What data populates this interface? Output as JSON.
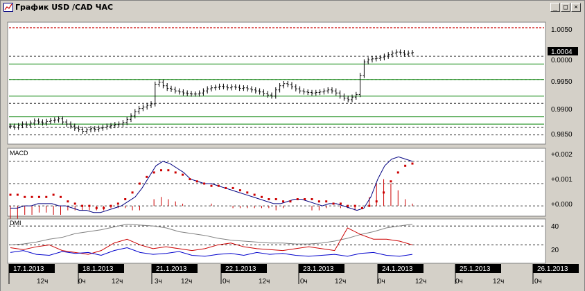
{
  "window": {
    "title": "График USD /CAD  ЧАС",
    "buttons": {
      "minimize": "_",
      "maximize": "□",
      "close": "×"
    }
  },
  "price_panel": {
    "axis_labels": [
      "1.0050",
      "0.9950",
      "0.9900",
      "0.9850"
    ],
    "current_price": "1.0004",
    "partial_label": "0.0000",
    "colors": {
      "bars": "#000000",
      "level_red": "#cc0000",
      "level_green": "#008000",
      "grid": "#000000"
    }
  },
  "macd_panel": {
    "label": "MACD",
    "axis_labels": [
      "+0.002",
      "+0.001",
      "+0.000"
    ],
    "colors": {
      "macd": "#000080",
      "signal": "#cc0000",
      "histogram": "#cc0000"
    }
  },
  "dmi_panel": {
    "label": "DMI",
    "axis_labels": [
      "40",
      "20"
    ],
    "colors": {
      "adx": "#808080",
      "plus_di": "#0000cc",
      "minus_di": "#cc0000"
    }
  },
  "time_axis": {
    "dates": [
      "17.1.2013",
      "18.1.2013",
      "21.1.2013",
      "22.1.2013",
      "23.1.2013",
      "24.1.2013",
      "25.1.2013",
      "26.1.2013"
    ],
    "ticks": [
      "12ч",
      "0ч",
      "12ч",
      "3ч",
      "12ч",
      "0ч",
      "12ч",
      "0ч",
      "12ч",
      "0ч",
      "12ч",
      "0ч",
      "12ч",
      "0ч"
    ]
  },
  "chart_data": [
    {
      "type": "ohlc",
      "title": "График USD /CAD  ЧАС",
      "ylim": [
        0.983,
        1.006
      ],
      "y_ticks": [
        1.005,
        0.995,
        0.99,
        0.985
      ],
      "levels": {
        "red": [
          1.0052
        ],
        "green": [
          0.9982,
          0.9952,
          0.992,
          0.988,
          0.9866
        ],
        "dashed": [
          0.9997,
          0.9952,
          0.9906,
          0.986,
          0.9845
        ]
      },
      "close": [
        0.9862,
        0.986,
        0.9863,
        0.9866,
        0.9864,
        0.9868,
        0.9872,
        0.987,
        0.9868,
        0.9871,
        0.9873,
        0.9874,
        0.9876,
        0.987,
        0.9866,
        0.9862,
        0.9858,
        0.9856,
        0.9852,
        0.9855,
        0.9857,
        0.9856,
        0.9858,
        0.986,
        0.9862,
        0.9863,
        0.9865,
        0.9866,
        0.9869,
        0.9875,
        0.9882,
        0.989,
        0.9896,
        0.9899,
        0.9902,
        0.9905,
        0.9943,
        0.9947,
        0.994,
        0.9935,
        0.9933,
        0.993,
        0.9928,
        0.9926,
        0.9925,
        0.9924,
        0.9924,
        0.9926,
        0.993,
        0.9934,
        0.9936,
        0.9937,
        0.9939,
        0.9938,
        0.9936,
        0.9938,
        0.9937,
        0.9935,
        0.9936,
        0.9934,
        0.9932,
        0.993,
        0.9928,
        0.9925,
        0.9922,
        0.992,
        0.9932,
        0.994,
        0.9944,
        0.9942,
        0.9938,
        0.9934,
        0.993,
        0.9928,
        0.9927,
        0.9926,
        0.9927,
        0.9928,
        0.993,
        0.9932,
        0.993,
        0.9926,
        0.992,
        0.9916,
        0.9913,
        0.9918,
        0.9923,
        0.996,
        0.9986,
        0.999,
        0.9992,
        0.9993,
        0.9994,
        0.9997,
        1.0,
        1.0003,
        1.0005,
        1.0004,
        1.0001,
        1.0003,
        1.0004
      ],
      "macd": [
        -0.0001,
        -0.0001,
        0.0,
        0.0,
        0.0001,
        0.0001,
        0.0001,
        0.0,
        0.0,
        -0.0001,
        -0.0002,
        -0.0002,
        -0.0003,
        -0.0003,
        -0.0002,
        -0.0001,
        0.0,
        0.0002,
        0.0004,
        0.0008,
        0.0013,
        0.0018,
        0.002,
        0.0019,
        0.0017,
        0.0015,
        0.0012,
        0.0011,
        0.001,
        0.001,
        0.0009,
        0.0008,
        0.0007,
        0.0006,
        0.0005,
        0.0004,
        0.0003,
        0.0002,
        0.0001,
        0.0001,
        0.0002,
        0.0003,
        0.0003,
        0.0002,
        0.0001,
        0.0,
        0.0001,
        0.0001,
        0.0,
        -0.0001,
        -0.0002,
        -0.0001,
        0.0004,
        0.0012,
        0.0018,
        0.0021,
        0.0022,
        0.0021,
        0.002
      ],
      "signal": [
        0.0005,
        0.0005,
        0.0004,
        0.0004,
        0.0004,
        0.0004,
        0.0005,
        0.0004,
        0.0002,
        0.0001,
        0.0,
        0.0,
        -0.0001,
        -0.0001,
        0.0,
        0.0001,
        0.0003,
        0.0006,
        0.001,
        0.0013,
        0.0015,
        0.0016,
        0.0016,
        0.0015,
        0.0014,
        0.0012,
        0.0011,
        0.001,
        0.0009,
        0.0009,
        0.0008,
        0.0008,
        0.0007,
        0.0006,
        0.0005,
        0.0004,
        0.0003,
        0.0003,
        0.0002,
        0.0002,
        0.0003,
        0.0003,
        0.0003,
        0.0002,
        0.0002,
        0.0001,
        0.0001,
        0.0,
        0.0,
        -0.0001,
        0.0,
        0.0002,
        0.0006,
        0.0011,
        0.0015,
        0.0018,
        0.0019
      ],
      "adx": [
        20,
        21,
        23,
        26,
        28,
        32,
        34,
        36,
        39,
        42,
        41,
        40,
        38,
        34,
        32,
        30,
        27,
        25,
        24,
        23,
        22,
        22,
        21,
        21,
        22,
        24,
        27,
        31,
        34,
        38,
        40,
        42
      ],
      "plus_di": [
        12,
        14,
        10,
        9,
        13,
        11,
        12,
        9,
        14,
        17,
        12,
        10,
        11,
        13,
        9,
        8,
        10,
        11,
        9,
        12,
        10,
        11,
        9,
        8,
        9,
        10,
        8,
        11,
        12,
        9,
        8,
        10
      ],
      "minus_di": [
        17,
        15,
        18,
        20,
        14,
        12,
        10,
        14,
        22,
        26,
        20,
        16,
        18,
        16,
        14,
        16,
        20,
        22,
        18,
        16,
        15,
        14,
        16,
        18,
        16,
        14,
        38,
        31,
        26,
        26,
        24,
        20
      ]
    }
  ]
}
